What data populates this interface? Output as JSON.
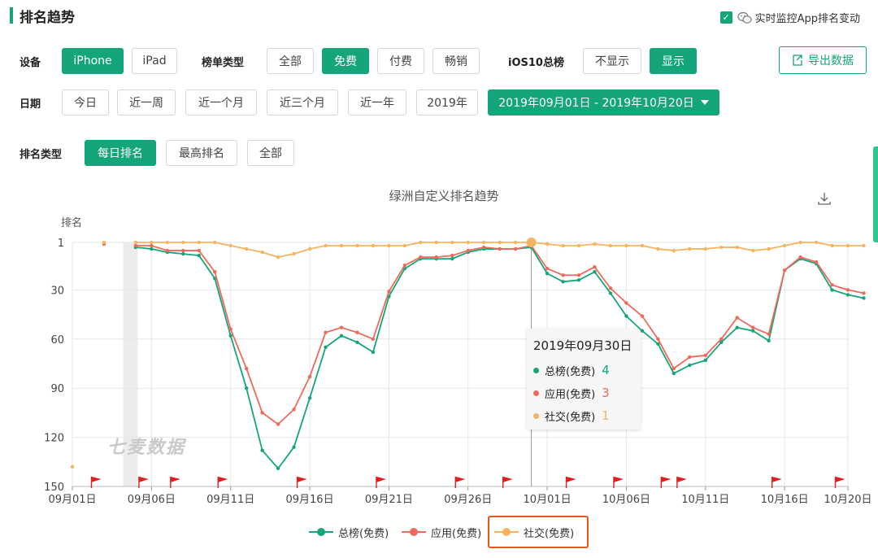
{
  "header": {
    "title": "排名趋势",
    "monitor_label": "实时监控App排名变动",
    "monitor_checked": true
  },
  "filters": {
    "device": {
      "label": "设备",
      "options": [
        "iPhone",
        "iPad"
      ],
      "selected": "iPhone"
    },
    "list_type": {
      "label": "榜单类型",
      "options": [
        "全部",
        "免费",
        "付费",
        "畅销"
      ],
      "selected": "免费"
    },
    "ios10": {
      "label": "iOS10总榜",
      "options": [
        "不显示",
        "显示"
      ],
      "selected": "显示"
    },
    "date": {
      "label": "日期",
      "options": [
        "今日",
        "近一周",
        "近一个月",
        "近三个月",
        "近一年",
        "2019年"
      ],
      "range": "2019年09月01日 - 2019年10月20日"
    },
    "rank_type": {
      "label": "排名类型",
      "options": [
        "每日排名",
        "最高排名",
        "全部"
      ],
      "selected": "每日排名"
    }
  },
  "export_label": "导出数据",
  "watermark": "七麦数据",
  "chart_data": {
    "type": "line",
    "title": "绿洲自定义排名趋势",
    "ylabel": "排名",
    "ylim": [
      150,
      1
    ],
    "y_ticks": [
      1,
      30,
      60,
      90,
      120,
      150
    ],
    "x_ticks": [
      "09月01日",
      "09月06日",
      "09月11日",
      "09月16日",
      "09月21日",
      "09月26日",
      "10月01日",
      "10月06日",
      "10月11日",
      "10月16日",
      "10月20日"
    ],
    "series": [
      {
        "name": "总榜(免费)",
        "color": "#14a57a",
        "points": [
          [
            4,
            4
          ],
          [
            5,
            5
          ],
          [
            6,
            7
          ],
          [
            7,
            8
          ],
          [
            8,
            9
          ],
          [
            9,
            23
          ],
          [
            10,
            58
          ],
          [
            11,
            90
          ],
          [
            12,
            128
          ],
          [
            13,
            139
          ],
          [
            14,
            126
          ],
          [
            15,
            96
          ],
          [
            16,
            65
          ],
          [
            17,
            58
          ],
          [
            18,
            62
          ],
          [
            19,
            68
          ],
          [
            20,
            34
          ],
          [
            21,
            17
          ],
          [
            22,
            11
          ],
          [
            23,
            11
          ],
          [
            24,
            11
          ],
          [
            25,
            7
          ],
          [
            26,
            5
          ],
          [
            27,
            5
          ],
          [
            28,
            5
          ],
          [
            29,
            4
          ],
          [
            30,
            20
          ],
          [
            31,
            25
          ],
          [
            32,
            24
          ],
          [
            33,
            19
          ],
          [
            34,
            32
          ],
          [
            35,
            46
          ],
          [
            36,
            55
          ],
          [
            37,
            63
          ],
          [
            38,
            81
          ],
          [
            39,
            76
          ],
          [
            40,
            73
          ],
          [
            41,
            62
          ],
          [
            42,
            53
          ],
          [
            43,
            55
          ],
          [
            44,
            61
          ],
          [
            45,
            18
          ],
          [
            46,
            11
          ],
          [
            47,
            14
          ],
          [
            48,
            30
          ],
          [
            49,
            33
          ],
          [
            50,
            35
          ]
        ]
      },
      {
        "name": "应用(免费)",
        "color": "#ef6a5a",
        "points": [
          [
            2,
            2
          ],
          [
            4,
            3
          ],
          [
            5,
            3
          ],
          [
            6,
            6
          ],
          [
            7,
            6
          ],
          [
            8,
            6
          ],
          [
            9,
            19
          ],
          [
            10,
            54
          ],
          [
            11,
            78
          ],
          [
            12,
            105
          ],
          [
            13,
            112
          ],
          [
            14,
            103
          ],
          [
            15,
            83
          ],
          [
            16,
            56
          ],
          [
            17,
            53
          ],
          [
            18,
            56
          ],
          [
            19,
            60
          ],
          [
            20,
            31
          ],
          [
            21,
            15
          ],
          [
            22,
            10
          ],
          [
            23,
            10
          ],
          [
            24,
            9
          ],
          [
            25,
            6
          ],
          [
            26,
            4
          ],
          [
            27,
            5
          ],
          [
            28,
            5
          ],
          [
            29,
            3
          ],
          [
            30,
            17
          ],
          [
            31,
            21
          ],
          [
            32,
            21
          ],
          [
            33,
            16
          ],
          [
            34,
            29
          ],
          [
            35,
            38
          ],
          [
            36,
            46
          ],
          [
            37,
            60
          ],
          [
            38,
            78
          ],
          [
            39,
            71
          ],
          [
            40,
            70
          ],
          [
            41,
            60
          ],
          [
            42,
            47
          ],
          [
            43,
            53
          ],
          [
            44,
            57
          ],
          [
            45,
            18
          ],
          [
            46,
            10
          ],
          [
            47,
            13
          ],
          [
            48,
            27
          ],
          [
            49,
            30
          ],
          [
            50,
            32
          ]
        ]
      },
      {
        "name": "社交(免费)",
        "color": "#f5b45f",
        "points": [
          [
            0,
            138
          ],
          [
            2,
            1
          ],
          [
            4,
            1
          ],
          [
            5,
            1
          ],
          [
            6,
            1
          ],
          [
            7,
            1
          ],
          [
            8,
            1
          ],
          [
            9,
            1
          ],
          [
            10,
            3
          ],
          [
            11,
            5
          ],
          [
            12,
            7
          ],
          [
            13,
            10
          ],
          [
            14,
            8
          ],
          [
            15,
            5
          ],
          [
            16,
            3
          ],
          [
            17,
            3
          ],
          [
            18,
            3
          ],
          [
            19,
            3
          ],
          [
            20,
            3
          ],
          [
            21,
            3
          ],
          [
            22,
            1
          ],
          [
            23,
            1
          ],
          [
            24,
            1
          ],
          [
            25,
            1
          ],
          [
            26,
            1
          ],
          [
            27,
            1
          ],
          [
            28,
            1
          ],
          [
            29,
            1
          ],
          [
            30,
            2
          ],
          [
            31,
            3
          ],
          [
            32,
            3
          ],
          [
            33,
            2
          ],
          [
            34,
            3
          ],
          [
            35,
            3
          ],
          [
            36,
            3
          ],
          [
            37,
            5
          ],
          [
            38,
            6
          ],
          [
            39,
            5
          ],
          [
            40,
            5
          ],
          [
            41,
            4
          ],
          [
            42,
            4
          ],
          [
            43,
            6
          ],
          [
            44,
            5
          ],
          [
            45,
            3
          ],
          [
            46,
            1
          ],
          [
            47,
            1
          ],
          [
            48,
            3
          ],
          [
            49,
            3
          ],
          [
            50,
            3
          ]
        ]
      }
    ],
    "hover": {
      "date": "2019年09月30日",
      "rows": [
        {
          "name": "总榜(免费)",
          "value": "4",
          "color": "#14a57a"
        },
        {
          "name": "应用(免费)",
          "value": "3",
          "color": "#ef6a5a"
        },
        {
          "name": "社交(免费)",
          "value": "1",
          "color": "#f5b45f"
        }
      ]
    },
    "flag_days": [
      1,
      4,
      6,
      9,
      14,
      19,
      24,
      27,
      31,
      34,
      37,
      38,
      44,
      48
    ],
    "highlighted_legend": "社交(免费)",
    "grid": true
  }
}
